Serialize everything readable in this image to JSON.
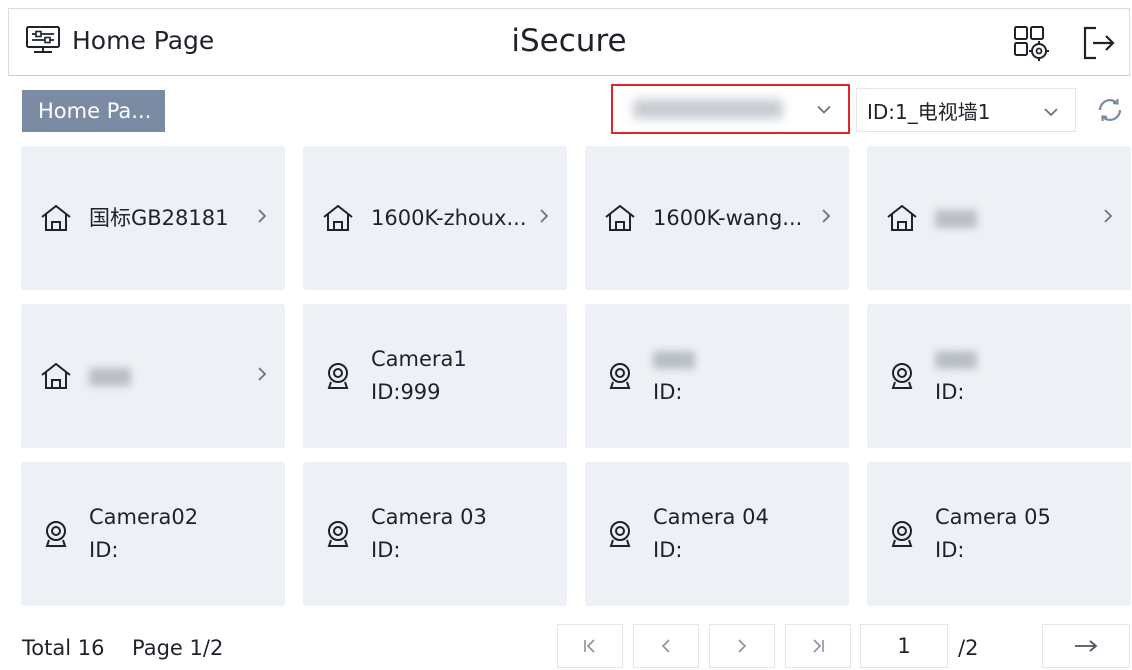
{
  "header": {
    "home_label": "Home Page",
    "app_title": "iSecure",
    "home_icon": "monitor-icon",
    "settings_icon": "grid-settings-icon",
    "logout_icon": "logout-icon"
  },
  "toolbar": {
    "breadcrumb": "Home Pa...",
    "server_select": {
      "value": ""
    },
    "wall_select": {
      "value": "ID:1_电视墙1"
    },
    "refresh_icon": "refresh-icon"
  },
  "cards": [
    {
      "type": "folder",
      "label": "国标GB28181",
      "blurred": false
    },
    {
      "type": "folder",
      "label": "1600K-zhoux...",
      "blurred": false
    },
    {
      "type": "folder",
      "label": "1600K-wang...",
      "blurred": false
    },
    {
      "type": "folder",
      "label": "",
      "blurred": true
    },
    {
      "type": "folder",
      "label": "",
      "blurred": true
    },
    {
      "type": "camera",
      "name": "Camera1",
      "id": "ID:999",
      "blurred": false
    },
    {
      "type": "camera",
      "name": "",
      "id": "ID:",
      "blurred": true
    },
    {
      "type": "camera",
      "name": "",
      "id": "ID:",
      "blurred": true
    },
    {
      "type": "camera",
      "name": "Camera02",
      "id": "ID:",
      "blurred": false
    },
    {
      "type": "camera",
      "name": "Camera 03",
      "id": "ID:",
      "blurred": false
    },
    {
      "type": "camera",
      "name": "Camera 04",
      "id": "ID:",
      "blurred": false
    },
    {
      "type": "camera",
      "name": "Camera 05",
      "id": "ID:",
      "blurred": false
    }
  ],
  "footer": {
    "total": "Total 16",
    "page": "Page 1/2",
    "page_input": "1",
    "page_total": "/2"
  },
  "colors": {
    "accent_red": "#e0262c",
    "breadcrumb_bg": "#7a8ba3",
    "card_bg": "#edf0f4"
  }
}
